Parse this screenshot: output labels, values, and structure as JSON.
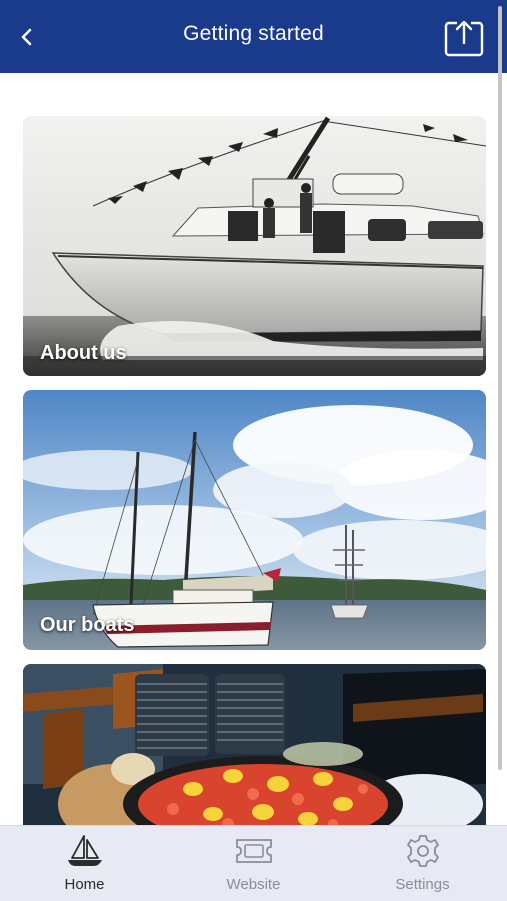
{
  "header": {
    "title": "Getting started"
  },
  "cards": [
    {
      "label": "About us"
    },
    {
      "label": "Our boats"
    },
    {
      "label": ""
    }
  ],
  "tabs": [
    {
      "label": "Home",
      "icon": "sailboat-icon",
      "active": true
    },
    {
      "label": "Website",
      "icon": "ticket-icon",
      "active": false
    },
    {
      "label": "Settings",
      "icon": "gear-icon",
      "active": false
    }
  ],
  "colors": {
    "header_bg": "#1a3a8c",
    "tabbar_bg": "#e7e9f3",
    "active_tab": "#2b2b2b",
    "inactive_tab": "#8a8d96"
  }
}
